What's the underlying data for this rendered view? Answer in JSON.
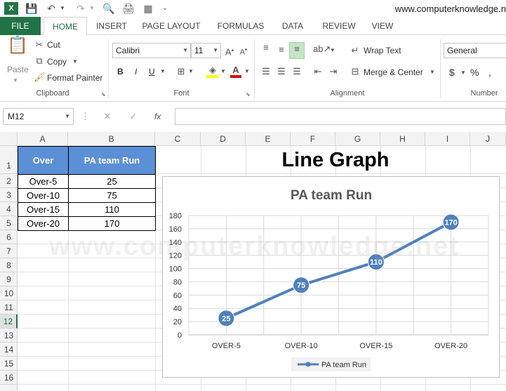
{
  "qat": {
    "site_url": "www.computerknowledge.n"
  },
  "tabs": [
    {
      "label": "FILE"
    },
    {
      "label": "HOME"
    },
    {
      "label": "INSERT"
    },
    {
      "label": "PAGE LAYOUT"
    },
    {
      "label": "FORMULAS"
    },
    {
      "label": "DATA"
    },
    {
      "label": "REVIEW"
    },
    {
      "label": "VIEW"
    }
  ],
  "clipboard": {
    "paste": "Paste",
    "cut": "Cut",
    "copy": "Copy",
    "format_painter": "Format Painter",
    "group_label": "Clipboard"
  },
  "font": {
    "name": "Calibri",
    "size": "11",
    "group_label": "Font",
    "bold": "B",
    "italic": "I",
    "underline": "U"
  },
  "alignment": {
    "wrap_text": "Wrap Text",
    "merge_center": "Merge & Center",
    "group_label": "Alignment"
  },
  "number": {
    "format": "General",
    "currency": "$",
    "percent": "%",
    "group_label": "Number"
  },
  "formula_bar": {
    "name_box": "M12",
    "fx": "fx",
    "value": ""
  },
  "grid": {
    "columns": [
      "A",
      "B",
      "C",
      "D",
      "E",
      "F",
      "G",
      "H",
      "I",
      "J"
    ],
    "rows": [
      "1",
      "2",
      "3",
      "4",
      "5",
      "6",
      "7",
      "8",
      "9",
      "10",
      "11",
      "12",
      "13",
      "14",
      "15",
      "16"
    ],
    "selected_row": "12"
  },
  "table": {
    "headers": [
      "Over",
      "PA team Run"
    ],
    "rows": [
      [
        "Over-5",
        "25"
      ],
      [
        "Over-10",
        "75"
      ],
      [
        "Over-15",
        "110"
      ],
      [
        "Over-20",
        "170"
      ]
    ]
  },
  "sheet_title": "Line Graph",
  "watermark": "www.computerknowledge.net",
  "colors": {
    "excel_green": "#217346",
    "header_blue": "#5b8fd6",
    "series": "#4f81bd"
  },
  "chart_data": {
    "type": "line",
    "title": "PA team Run",
    "categories": [
      "OVER-5",
      "OVER-10",
      "OVER-15",
      "OVER-20"
    ],
    "series": [
      {
        "name": "PA team Run",
        "values": [
          25,
          75,
          110,
          170
        ]
      }
    ],
    "ylim": [
      0,
      180
    ],
    "yticks": [
      0,
      20,
      40,
      60,
      80,
      100,
      120,
      140,
      160,
      180
    ],
    "grid": true,
    "legend": "bottom"
  }
}
